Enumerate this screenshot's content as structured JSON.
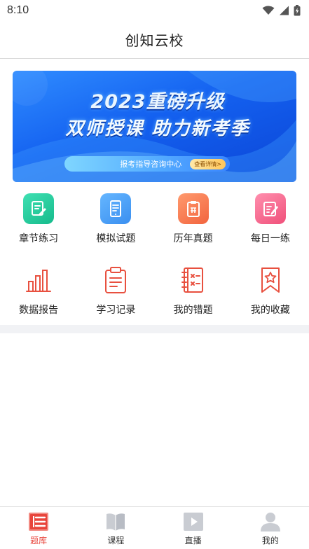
{
  "status_bar": {
    "time": "8:10"
  },
  "header": {
    "title": "创知云校"
  },
  "banner": {
    "line1": "2023重磅升级",
    "line2": "双师授课 助力新考季",
    "pill_text": "报考指导咨询中心",
    "pill_button": "查看详情>"
  },
  "grid_row1": [
    {
      "label": "章节练习",
      "icon": "edit-note-icon",
      "color": "#1fc796"
    },
    {
      "label": "模拟试题",
      "icon": "tablet-icon",
      "color": "#4a9df5"
    },
    {
      "label": "历年真题",
      "icon": "clipboard-icon",
      "color": "#f4704a"
    },
    {
      "label": "每日一练",
      "icon": "edit-doc-icon",
      "color": "#f5628a"
    }
  ],
  "grid_row2": [
    {
      "label": "数据报告",
      "icon": "bar-chart-icon",
      "color": "#e8503f"
    },
    {
      "label": "学习记录",
      "icon": "clipboard-list-icon",
      "color": "#e8503f"
    },
    {
      "label": "我的错题",
      "icon": "wrong-book-icon",
      "color": "#e8503f"
    },
    {
      "label": "我的收藏",
      "icon": "star-bookmark-icon",
      "color": "#e8503f"
    }
  ],
  "tabbar": [
    {
      "label": "题库",
      "icon": "question-bank-icon",
      "active": true
    },
    {
      "label": "课程",
      "icon": "book-icon",
      "active": false
    },
    {
      "label": "直播",
      "icon": "play-icon",
      "active": false
    },
    {
      "label": "我的",
      "icon": "user-icon",
      "active": false
    }
  ],
  "colors": {
    "accent": "#e8453c",
    "inactive_icon": "#c9ccd2",
    "banner_blue": "#1461f0"
  }
}
